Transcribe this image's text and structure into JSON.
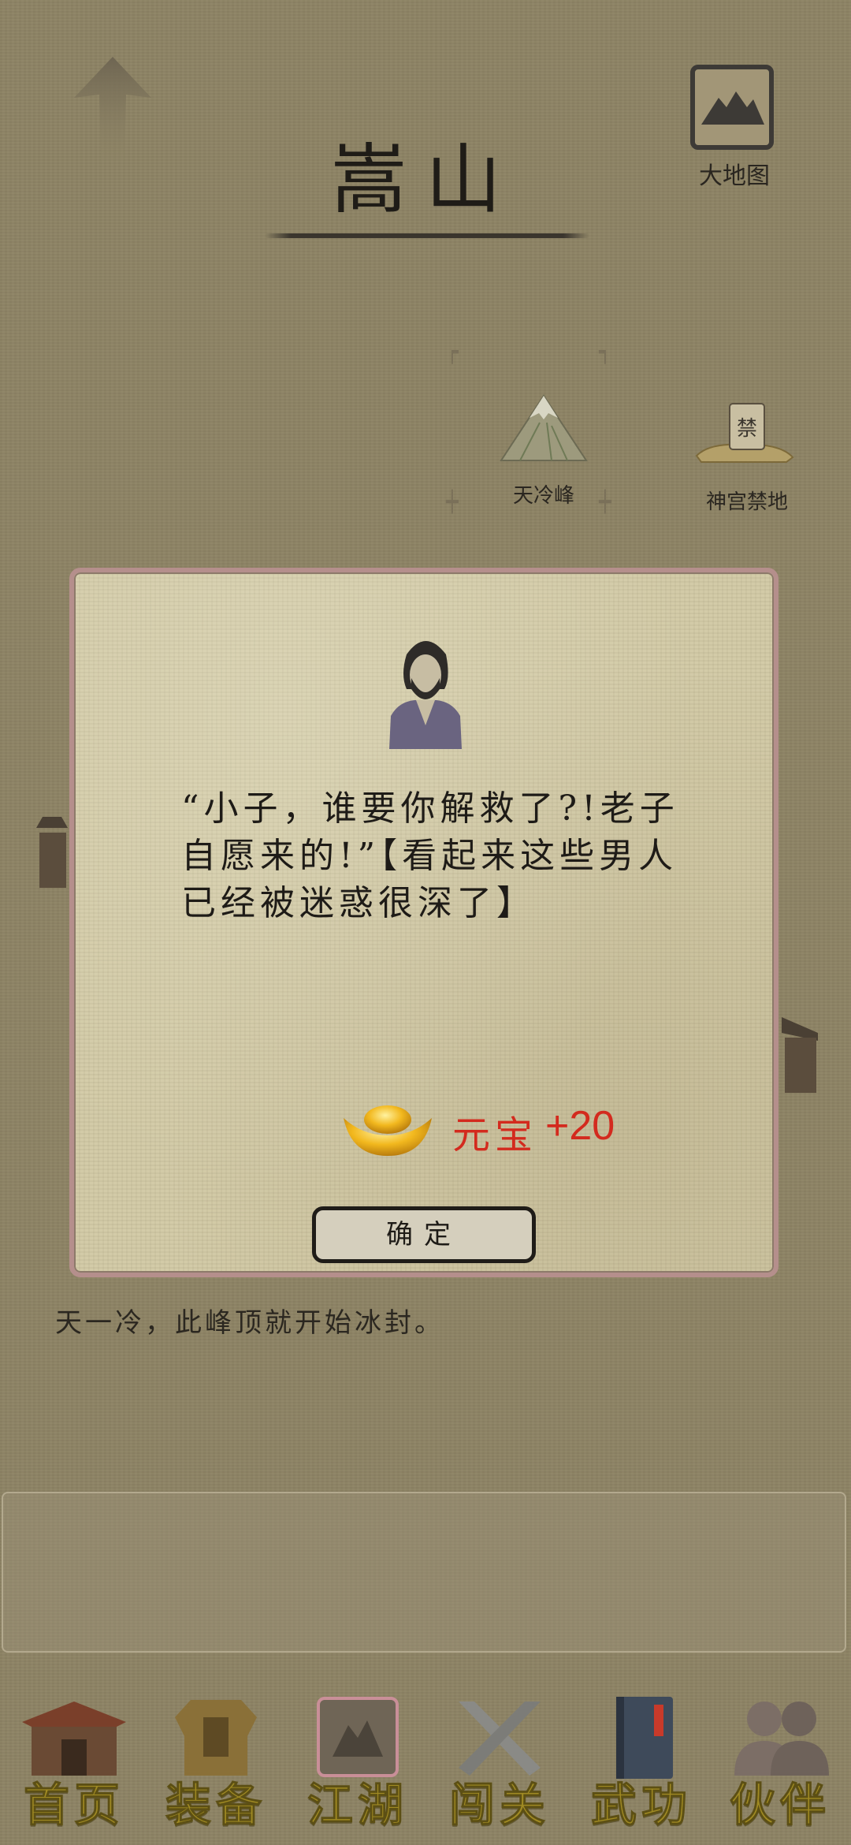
{
  "header": {
    "title": "嵩山",
    "world_map_label": "大地图"
  },
  "map": {
    "nodes": [
      {
        "label": "天冷峰"
      },
      {
        "label": "神宫禁地"
      }
    ],
    "description": "天一冷，此峰顶就开始冰封。"
  },
  "popup": {
    "dialog": "“小子，谁要你解救了?!老子自愿来的!”【看起来这些男人已经被迷惑很深了】",
    "reward_name": "元宝",
    "reward_amount": "+20",
    "confirm_label": "确定"
  },
  "bottom_nav": {
    "items": [
      {
        "label": "首页",
        "icon": "building-icon"
      },
      {
        "label": "装备",
        "icon": "armor-icon"
      },
      {
        "label": "江湖",
        "icon": "scroll-map-icon",
        "active": true
      },
      {
        "label": "闯关",
        "icon": "crossed-swords-icon"
      },
      {
        "label": "武功",
        "icon": "book-icon"
      },
      {
        "label": "伙伴",
        "icon": "companions-icon"
      }
    ]
  },
  "colors": {
    "background": "#8e8465",
    "reward_red": "#d32a1e",
    "nav_gold": "#a08a23",
    "popup_border": "#b58f8c"
  }
}
